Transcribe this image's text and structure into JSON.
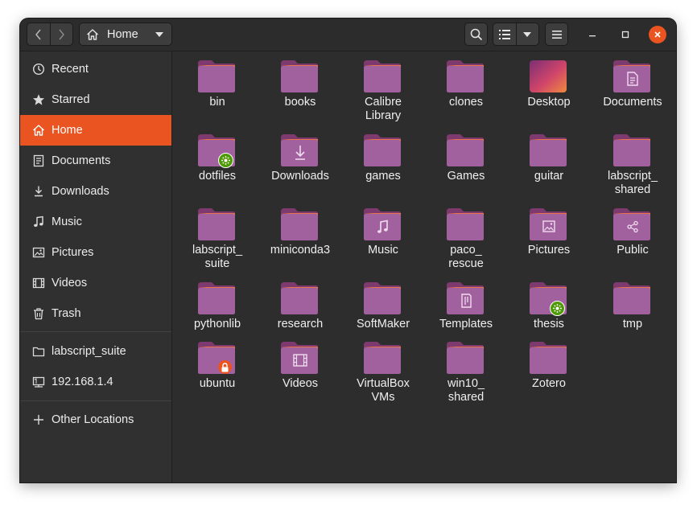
{
  "header": {
    "path_label": "Home",
    "icons": [
      "back-icon",
      "forward-icon",
      "home-icon",
      "search-icon",
      "list-view-icon",
      "chevron-down-icon",
      "hamburger-menu-icon",
      "minimize-icon",
      "maximize-icon",
      "close-icon"
    ]
  },
  "sidebar": {
    "items": [
      {
        "label": "Recent",
        "icon": "clock-icon"
      },
      {
        "label": "Starred",
        "icon": "star-icon"
      },
      {
        "label": "Home",
        "icon": "home-icon",
        "active": true
      },
      {
        "label": "Documents",
        "icon": "document-icon"
      },
      {
        "label": "Downloads",
        "icon": "download-icon"
      },
      {
        "label": "Music",
        "icon": "music-note-icon"
      },
      {
        "label": "Pictures",
        "icon": "picture-icon"
      },
      {
        "label": "Videos",
        "icon": "film-icon"
      },
      {
        "label": "Trash",
        "icon": "trash-icon"
      }
    ],
    "mounts": [
      {
        "label": "labscript_suite",
        "icon": "folder-icon"
      },
      {
        "label": "192.168.1.4",
        "icon": "network-drive-icon"
      }
    ],
    "other": {
      "label": "Other Locations",
      "icon": "plus-icon"
    }
  },
  "files": [
    {
      "l1": "bin",
      "l2": ""
    },
    {
      "l1": "books",
      "l2": ""
    },
    {
      "l1": "Calibre",
      "l2": "Library"
    },
    {
      "l1": "clones",
      "l2": ""
    },
    {
      "l1": "Desktop",
      "l2": ""
    },
    {
      "l1": "Documents",
      "l2": ""
    },
    {
      "l1": "dotfiles",
      "l2": ""
    },
    {
      "l1": "Downloads",
      "l2": ""
    },
    {
      "l1": "games",
      "l2": ""
    },
    {
      "l1": "Games",
      "l2": ""
    },
    {
      "l1": "guitar",
      "l2": ""
    },
    {
      "l1": "labscript_",
      "l2": "shared"
    },
    {
      "l1": "labscript_",
      "l2": "suite"
    },
    {
      "l1": "miniconda3",
      "l2": ""
    },
    {
      "l1": "Music",
      "l2": ""
    },
    {
      "l1": "paco_",
      "l2": "rescue"
    },
    {
      "l1": "Pictures",
      "l2": ""
    },
    {
      "l1": "Public",
      "l2": ""
    },
    {
      "l1": "pythonlib",
      "l2": ""
    },
    {
      "l1": "research",
      "l2": ""
    },
    {
      "l1": "SoftMaker",
      "l2": ""
    },
    {
      "l1": "Templates",
      "l2": ""
    },
    {
      "l1": "thesis",
      "l2": ""
    },
    {
      "l1": "tmp",
      "l2": ""
    },
    {
      "l1": "ubuntu",
      "l2": ""
    },
    {
      "l1": "Videos",
      "l2": ""
    },
    {
      "l1": "VirtualBox",
      "l2": "VMs"
    },
    {
      "l1": "win10_",
      "l2": "shared"
    },
    {
      "l1": "Zotero",
      "l2": ""
    }
  ],
  "colors": {
    "accent": "#e95420",
    "folder_body": "#a0619e",
    "folder_tab": "#7e3a6e",
    "emblem_green": "#4e9a06",
    "emblem_lock": "#e95420"
  }
}
